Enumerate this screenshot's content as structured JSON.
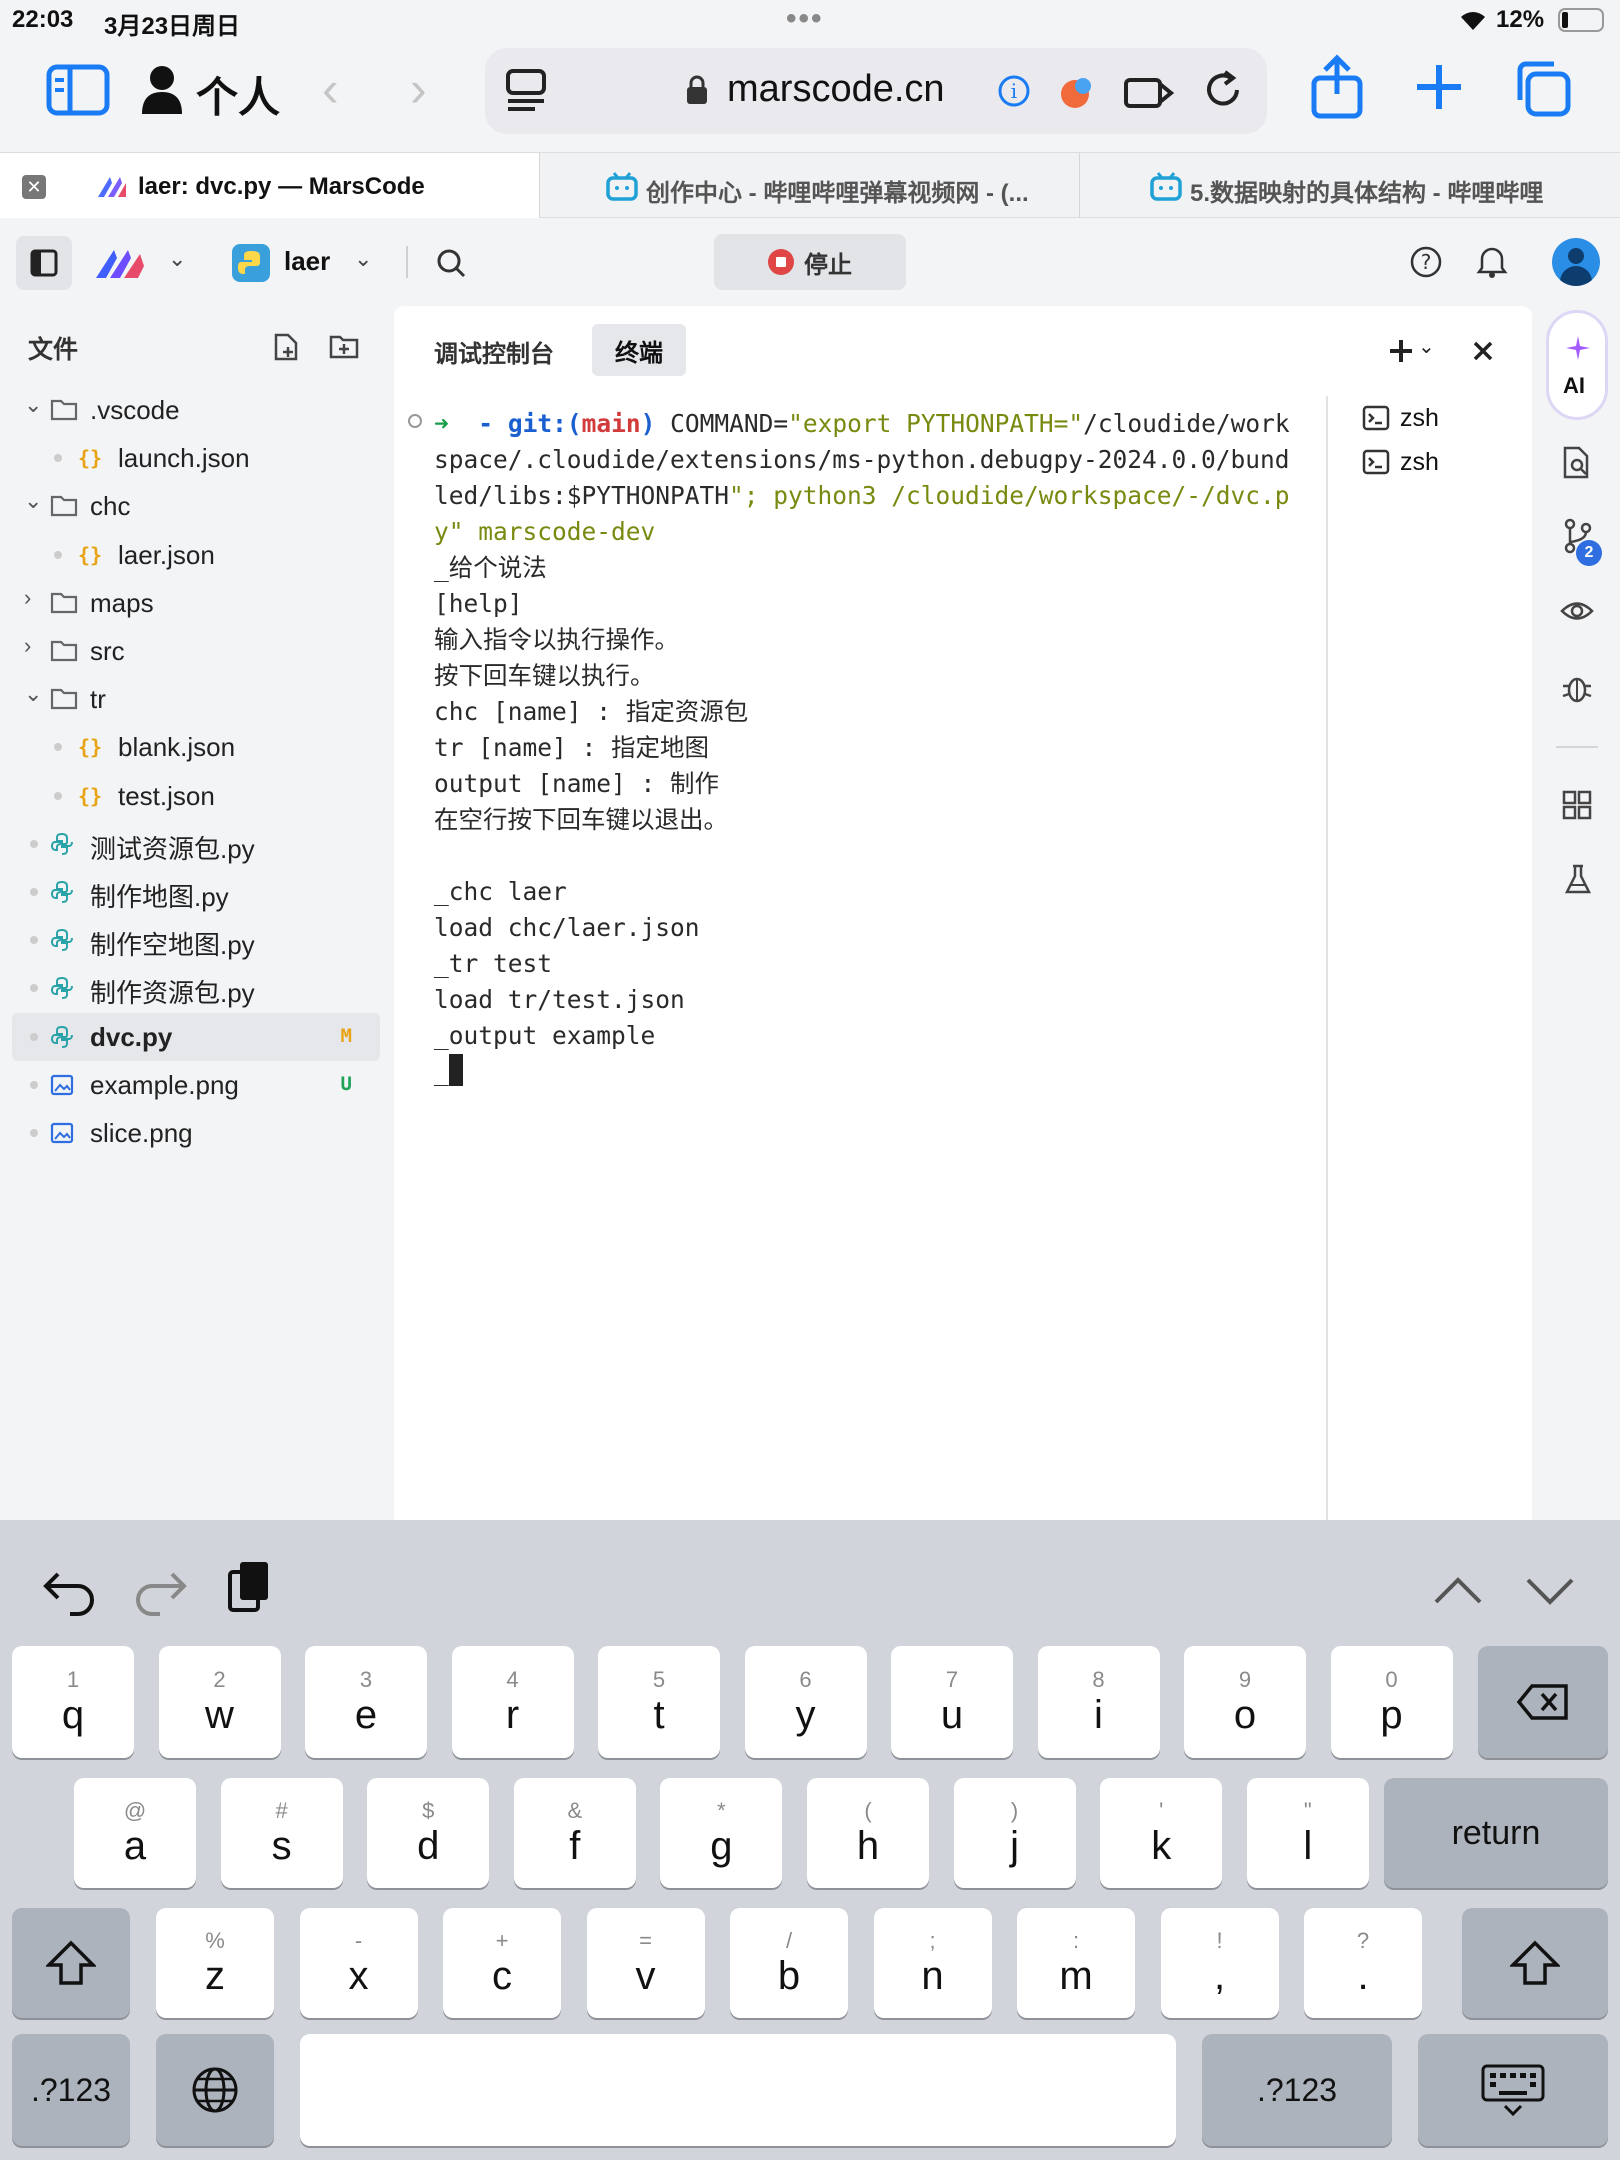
{
  "status": {
    "time": "22:03",
    "date": "3月23日周日",
    "battery": "12%"
  },
  "browser": {
    "profile": "个人",
    "url": "marscode.cn"
  },
  "tabs": [
    {
      "title": "laer: dvc.py — MarsCode"
    },
    {
      "title": "创作中心 - 哔哩哔哩弹幕视频网 - (..."
    },
    {
      "title": "5.数据映射的具体结构 - 哔哩哔哩"
    }
  ],
  "ide": {
    "project": "laer",
    "stop_label": "停止"
  },
  "explorer": {
    "title": "文件",
    "items": [
      {
        "label": ".vscode",
        "kind": "folder",
        "open": true,
        "depth": 0
      },
      {
        "label": "launch.json",
        "kind": "json",
        "depth": 1
      },
      {
        "label": "chc",
        "kind": "folder",
        "open": true,
        "depth": 0
      },
      {
        "label": "laer.json",
        "kind": "json",
        "depth": 1
      },
      {
        "label": "maps",
        "kind": "folder",
        "open": false,
        "depth": 0
      },
      {
        "label": "src",
        "kind": "folder",
        "open": false,
        "depth": 0
      },
      {
        "label": "tr",
        "kind": "folder",
        "open": true,
        "depth": 0
      },
      {
        "label": "blank.json",
        "kind": "json",
        "depth": 1
      },
      {
        "label": "test.json",
        "kind": "json",
        "depth": 1
      },
      {
        "label": "测试资源包.py",
        "kind": "py",
        "depth": 0
      },
      {
        "label": "制作地图.py",
        "kind": "py",
        "depth": 0
      },
      {
        "label": "制作空地图.py",
        "kind": "py",
        "depth": 0
      },
      {
        "label": "制作资源包.py",
        "kind": "py",
        "depth": 0
      },
      {
        "label": "dvc.py",
        "kind": "py",
        "depth": 0,
        "selected": true,
        "badge": "M",
        "badge_color": "#e8a317"
      },
      {
        "label": "example.png",
        "kind": "png",
        "depth": 0,
        "badge": "U",
        "badge_color": "#22a35a"
      },
      {
        "label": "slice.png",
        "kind": "png",
        "depth": 0
      }
    ]
  },
  "panel": {
    "tabs": [
      "调试控制台",
      "终端"
    ],
    "terminals": [
      "zsh",
      "zsh"
    ],
    "prompt_arrow": "➜",
    "prompt_dash": "-",
    "git_prefix": "git:(",
    "git_branch": "main",
    "git_suffix": ")",
    "cmd_part1": " COMMAND=",
    "cmd_str1": "\"export PYTHONPATH=\"",
    "cmd_part2": "/cloudide/workspace/.cloudide/extensions/ms-python.debugpy-2024.0.0/bundled/libs:$PYTHONPATH",
    "cmd_str2": "\"; python3 /cloudide/workspace/-/dvc.py\" marscode-dev",
    "output": "_给个说法\n[help]\n输入指令以执行操作。\n按下回车键以执行。\nchc [name] : 指定资源包\ntr [name] : 指定地图\noutput [name] : 制作\n在空行按下回车键以退出。\n\n_chc laer\nload chc/laer.json\n_tr test\nload tr/test.json\n_output example\n_"
  },
  "rightbar": {
    "ai_label": "AI",
    "scm_count": "2"
  },
  "keyboard": {
    "row1": [
      [
        "1",
        "q"
      ],
      [
        "2",
        "w"
      ],
      [
        "3",
        "e"
      ],
      [
        "4",
        "r"
      ],
      [
        "5",
        "t"
      ],
      [
        "6",
        "y"
      ],
      [
        "7",
        "u"
      ],
      [
        "8",
        "i"
      ],
      [
        "9",
        "o"
      ],
      [
        "0",
        "p"
      ]
    ],
    "row2": [
      [
        "@",
        "a"
      ],
      [
        "#",
        "s"
      ],
      [
        "$",
        "d"
      ],
      [
        "&",
        "f"
      ],
      [
        "*",
        "g"
      ],
      [
        "(",
        "h"
      ],
      [
        ")",
        "j"
      ],
      [
        "'",
        "k"
      ],
      [
        "\"",
        "l"
      ]
    ],
    "row3": [
      [
        "%",
        "z"
      ],
      [
        "-",
        "x"
      ],
      [
        "+",
        "c"
      ],
      [
        "=",
        "v"
      ],
      [
        "/",
        "b"
      ],
      [
        ";",
        "n"
      ],
      [
        ":",
        "m"
      ],
      [
        "!",
        ","
      ],
      [
        "?",
        "."
      ]
    ],
    "return_label": "return",
    "numbers_label": ".?123"
  }
}
